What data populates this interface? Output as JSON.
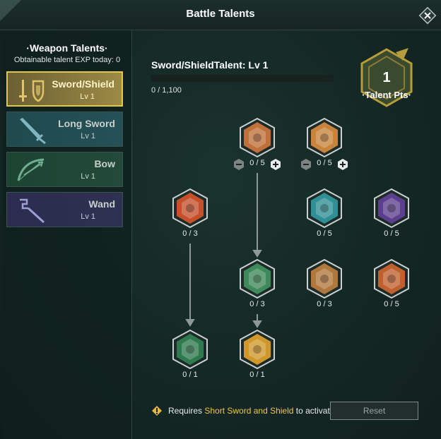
{
  "window": {
    "title": "Battle Talents"
  },
  "sidebar": {
    "heading": "Weapon Talents",
    "subheading": "Obtainable talent EXP today: 0",
    "weapons": [
      {
        "name": "Sword/Shield",
        "level": "Lv 1",
        "selected": true,
        "icon": "sword-shield-icon"
      },
      {
        "name": "Long Sword",
        "level": "Lv 1",
        "selected": false,
        "icon": "long-sword-icon"
      },
      {
        "name": "Bow",
        "level": "Lv 1",
        "selected": false,
        "icon": "bow-icon"
      },
      {
        "name": "Wand",
        "level": "Lv 1",
        "selected": false,
        "icon": "wand-icon"
      }
    ]
  },
  "talent": {
    "title": "Sword/ShieldTalent: Lv 1",
    "exp_text": "0 / 1,100",
    "exp_fraction": 0
  },
  "points": {
    "value": "1",
    "label": "Talent Pts"
  },
  "nodes": [
    {
      "count": "0 / 5",
      "icon": "shield-bash-icon",
      "color": "#c0703a"
    },
    {
      "count": "0 / 5",
      "icon": "sword-blade-icon",
      "color": "#c8843c"
    },
    {
      "count": "0 / 3",
      "icon": "fist-flame-icon",
      "color": "#c5502a"
    },
    {
      "count": "0 / 5",
      "icon": "iron-shield-icon",
      "color": "#2f8f95"
    },
    {
      "count": "0 / 5",
      "icon": "arcane-seal-icon",
      "color": "#5b3f8e"
    },
    {
      "count": "0 / 3",
      "icon": "guard-shield-icon",
      "color": "#3e8a5a"
    },
    {
      "count": "0 / 3",
      "icon": "golden-shield-icon",
      "color": "#b0783c"
    },
    {
      "count": "0 / 5",
      "icon": "thumbs-up-icon",
      "color": "#c0602f"
    },
    {
      "count": "0 / 1",
      "icon": "beast-face-icon",
      "color": "#2e7a4e"
    },
    {
      "count": "0 / 1",
      "icon": "crest-shield-icon",
      "color": "#d0982a"
    }
  ],
  "footer": {
    "note_prefix": "Requires ",
    "note_highlight": "Short Sword and Shield",
    "note_suffix": " to activat",
    "reset_label": "Reset"
  },
  "colors": {
    "gold": "#e2c84a",
    "highlight": "#f0c64a"
  }
}
